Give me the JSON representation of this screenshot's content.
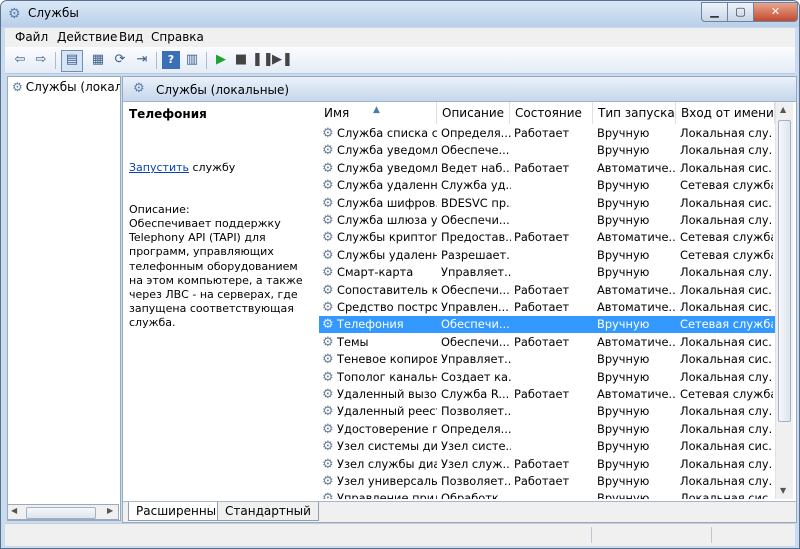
{
  "window": {
    "title": "Службы"
  },
  "menu": [
    {
      "label": "Файл"
    },
    {
      "label": "Действие"
    },
    {
      "label": "Вид"
    },
    {
      "label": "Справка"
    }
  ],
  "toolbar_icons": [
    "back-icon",
    "forward-icon",
    "console-tree-icon",
    "properties-icon",
    "refresh-icon",
    "export-icon",
    "help-icon",
    "show-action-pane-icon",
    "start-icon",
    "stop-icon",
    "pause-icon",
    "restart-icon"
  ],
  "tree": {
    "root_label": "Службы (локалы"
  },
  "panel": {
    "header": "Службы (локальные)"
  },
  "detail": {
    "title": "Телефония",
    "link_text": "Запустить",
    "link_suffix": " службу",
    "desc_label": "Описание:",
    "description": "Обеспечивает поддержку Telephony API (TAPI) для программ, управляющих телефонным оборудованием на этом компьютере, а также через ЛВС - на серверах, где запущена соответствующая служба."
  },
  "columns": [
    "Имя",
    "Описание",
    "Состояние",
    "Тип запуска",
    "Вход от имени"
  ],
  "rows": [
    {
      "name": "Служба списка с...",
      "desc": "Определя...",
      "state": "Работает",
      "startup": "Вручную",
      "logon": "Локальная слу..."
    },
    {
      "name": "Служба уведомл...",
      "desc": "Обеспече...",
      "state": "",
      "startup": "Вручную",
      "logon": "Локальная слу..."
    },
    {
      "name": "Служба уведомл...",
      "desc": "Ведет наб...",
      "state": "Работает",
      "startup": "Автоматиче...",
      "logon": "Локальная сис..."
    },
    {
      "name": "Служба удаленн...",
      "desc": "Служба уд...",
      "state": "",
      "startup": "Вручную",
      "logon": "Сетевая служба"
    },
    {
      "name": "Служба шифров...",
      "desc": "BDESVC пр...",
      "state": "",
      "startup": "Вручную",
      "logon": "Локальная сис..."
    },
    {
      "name": "Служба шлюза у...",
      "desc": "Обеспечи...",
      "state": "",
      "startup": "Вручную",
      "logon": "Локальная слу..."
    },
    {
      "name": "Службы криптог...",
      "desc": "Предостав...",
      "state": "Работает",
      "startup": "Автоматиче...",
      "logon": "Сетевая служба"
    },
    {
      "name": "Службы удаленн...",
      "desc": "Разрешает...",
      "state": "",
      "startup": "Вручную",
      "logon": "Сетевая служба"
    },
    {
      "name": "Смарт-карта",
      "desc": "Управляет...",
      "state": "",
      "startup": "Вручную",
      "logon": "Локальная слу..."
    },
    {
      "name": "Сопоставитель к...",
      "desc": "Обеспечи...",
      "state": "Работает",
      "startup": "Автоматиче...",
      "logon": "Локальная сис..."
    },
    {
      "name": "Средство постро...",
      "desc": "Управлен...",
      "state": "Работает",
      "startup": "Автоматиче...",
      "logon": "Локальная сис..."
    },
    {
      "name": "Телефония",
      "desc": "Обеспечи...",
      "state": "",
      "startup": "Вручную",
      "logon": "Сетевая служба",
      "selected": true
    },
    {
      "name": "Темы",
      "desc": "Обеспечи...",
      "state": "Работает",
      "startup": "Автоматиче...",
      "logon": "Локальная сис..."
    },
    {
      "name": "Теневое копиров...",
      "desc": "Управляет...",
      "state": "",
      "startup": "Вручную",
      "logon": "Локальная сис..."
    },
    {
      "name": "Тополог канальн...",
      "desc": "Создает ка...",
      "state": "",
      "startup": "Вручную",
      "logon": "Локальная слу..."
    },
    {
      "name": "Удаленный вызо...",
      "desc": "Служба R...",
      "state": "Работает",
      "startup": "Автоматиче...",
      "logon": "Сетевая служба"
    },
    {
      "name": "Удаленный реестр",
      "desc": "Позволяет...",
      "state": "",
      "startup": "Вручную",
      "logon": "Локальная слу..."
    },
    {
      "name": "Удостоверение п...",
      "desc": "Определя...",
      "state": "",
      "startup": "Вручную",
      "logon": "Локальная слу..."
    },
    {
      "name": "Узел системы ди...",
      "desc": "Узел систе...",
      "state": "",
      "startup": "Вручную",
      "logon": "Локальная сис..."
    },
    {
      "name": "Узел службы диа...",
      "desc": "Узел служ...",
      "state": "Работает",
      "startup": "Вручную",
      "logon": "Локальная слу..."
    },
    {
      "name": "Узел универсаль...",
      "desc": "Позволяет...",
      "state": "Работает",
      "startup": "Вручную",
      "logon": "Локальная слу..."
    },
    {
      "name": "Управление прил...",
      "desc": "Обработк...",
      "state": "",
      "startup": "Вручную",
      "logon": "Локальная сис..."
    }
  ],
  "tabs": [
    {
      "label": "Расширенный",
      "active": true
    },
    {
      "label": "Стандартный",
      "active": false
    }
  ]
}
